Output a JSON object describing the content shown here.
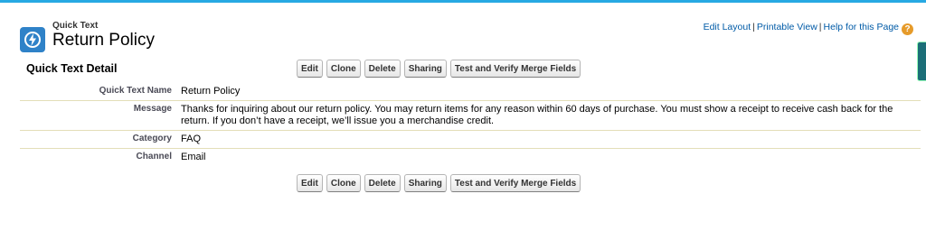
{
  "header": {
    "object_label": "Quick Text",
    "title": "Return Policy"
  },
  "links": {
    "edit_layout": "Edit Layout",
    "printable_view": "Printable View",
    "help": "Help for this Page",
    "separator": "|"
  },
  "detail": {
    "section_title": "Quick Text Detail",
    "buttons": {
      "edit": "Edit",
      "clone": "Clone",
      "delete": "Delete",
      "sharing": "Sharing",
      "test_merge": "Test and Verify Merge Fields"
    },
    "fields": [
      {
        "label": "Quick Text Name",
        "value": "Return Policy"
      },
      {
        "label": "Message",
        "value": "Thanks for inquiring about our return policy. You may return items for any reason within 60 days of purchase. You must show a receipt to receive cash back for the return. If you don’t have a receipt, we’ll issue you a merchandise credit."
      },
      {
        "label": "Category",
        "value": "FAQ"
      },
      {
        "label": "Channel",
        "value": "Email"
      }
    ]
  },
  "icons": {
    "object_icon": "quick-text-lightning-icon",
    "help_icon": "question-mark-icon"
  },
  "colors": {
    "top_bar": "#27a9e3",
    "icon_bg": "#2f82c8",
    "link": "#015ba7",
    "help_icon": "#e69b2a"
  }
}
